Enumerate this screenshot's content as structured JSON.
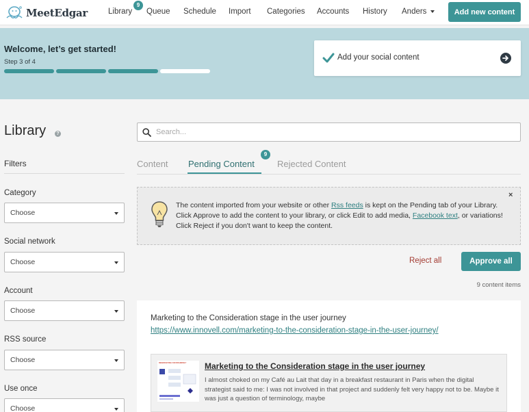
{
  "app": {
    "name": "MeetEdgar"
  },
  "nav": {
    "items": [
      "Library",
      "Queue",
      "Schedule",
      "Import",
      "Categories",
      "Accounts",
      "History"
    ],
    "library_badge": "9",
    "user": "Anders",
    "add_button": "Add new content"
  },
  "onboarding": {
    "title": "Welcome, let’s get started!",
    "step": "Step 3 of 4",
    "steps_total": 4,
    "steps_completed": 3,
    "task": "Add your social content"
  },
  "library": {
    "title": "Library",
    "help_icon": "?",
    "filters_title": "Filters",
    "filters": [
      {
        "label": "Category",
        "value": "Choose"
      },
      {
        "label": "Social network",
        "value": "Choose"
      },
      {
        "label": "Account",
        "value": "Choose"
      },
      {
        "label": "RSS source",
        "value": "Choose"
      },
      {
        "label": "Use once",
        "value": "Choose"
      }
    ]
  },
  "search": {
    "placeholder": "Search..."
  },
  "tabs": {
    "content": "Content",
    "pending": "Pending Content",
    "pending_badge": "9",
    "rejected": "Rejected Content",
    "active": "pending"
  },
  "notice": {
    "text_1": "The content imported from your website or other ",
    "link_rss": "Rss feeds",
    "text_2": " is kept on the Pending tab of your Library. Click Approve to add the content to your library, or click Edit to add media, ",
    "link_facebook": "Facebook text",
    "text_3": ", or variations! Click Reject if you don't want to keep the content.",
    "close": "×"
  },
  "actions": {
    "reject_all": "Reject all",
    "approve_all": "Approve all",
    "count": "9 content items"
  },
  "item": {
    "title": "Marketing to the Consideration stage in the user journey",
    "url": "https://www.innovell.com/marketing-to-the-consideration-stage-in-the-user-journey/",
    "preview_title": "Marketing to the Consideration stage in the user journey",
    "preview_desc": "I almost choked on my Café au Lait that day in a breakfast restaurant in Paris when the digital strategist said to me: I was not involved in that project and suddenly felt very happy not to be. Maybe it was just a question of terminology, maybe",
    "thumb_caption": "REMARKETING FOR BRANDING?"
  },
  "colors": {
    "accent": "#3d9597",
    "banner": "#bad8de",
    "reject": "#a33b32",
    "link": "#2e7f80"
  }
}
